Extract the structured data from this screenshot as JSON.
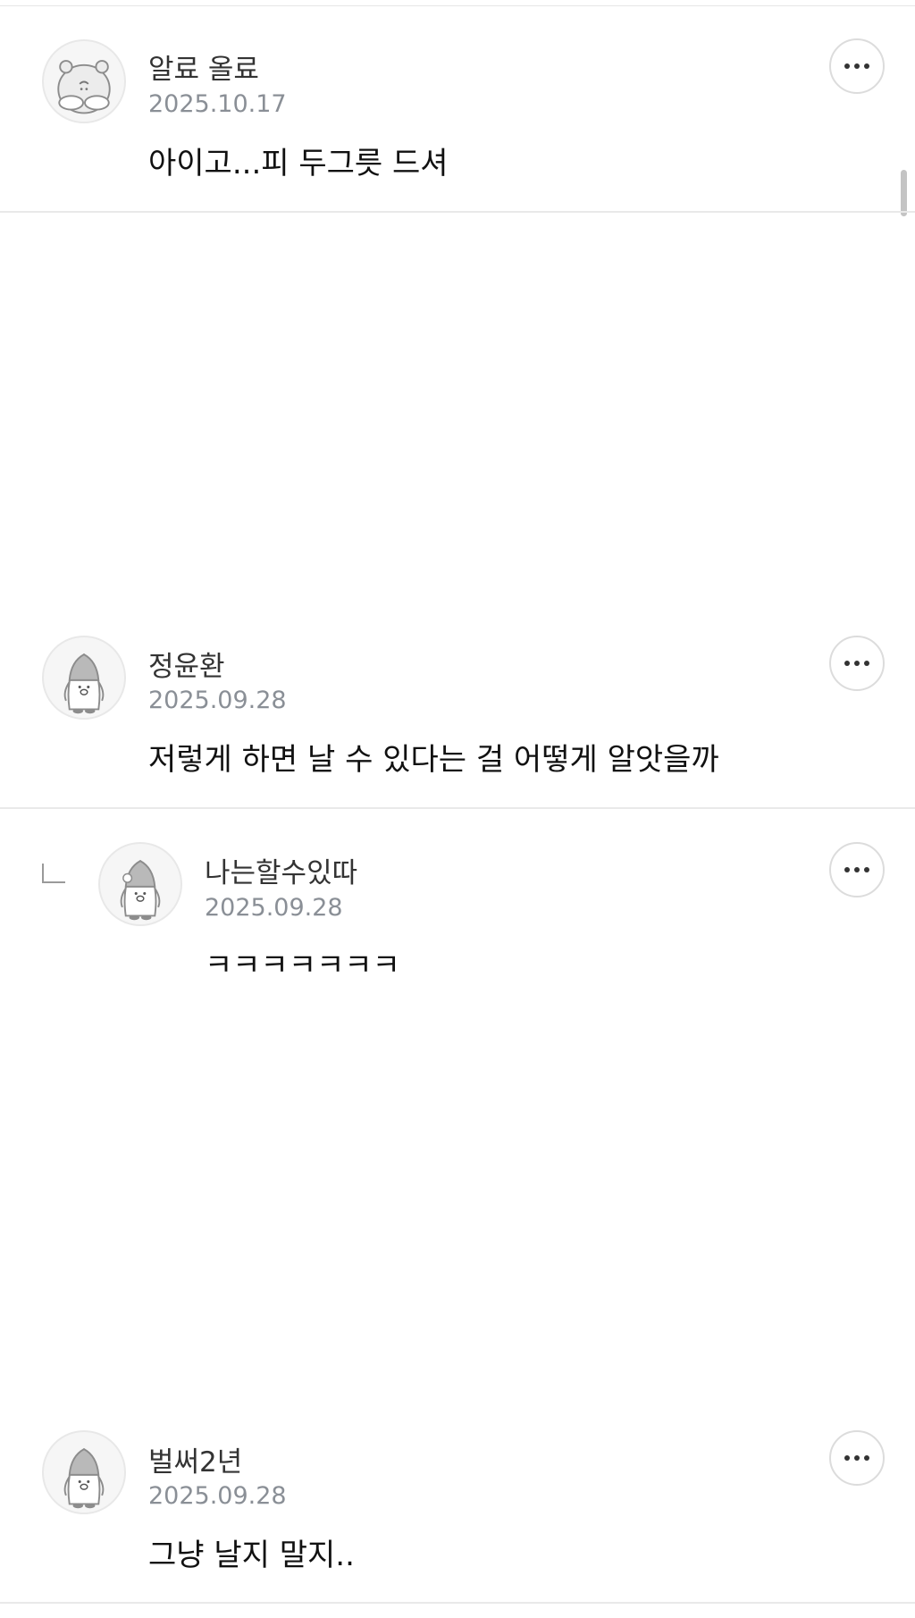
{
  "comments": [
    {
      "author": "알료 올료",
      "date": "2025.10.17",
      "text": "아이고...피 두그릇 드셔",
      "avatar_icon": "hamster-avatar-icon",
      "is_reply": false
    },
    {
      "author": "정윤환",
      "date": "2025.09.28",
      "text": "저렇게 하면 날 수 있다는 걸 어떻게 알앗을까",
      "avatar_icon": "penguin-avatar-icon",
      "is_reply": false
    },
    {
      "author": "나는할수있따",
      "date": "2025.09.28",
      "text": "ㅋㅋㅋㅋㅋㅋㅋ",
      "avatar_icon": "penguin-avatar-icon",
      "is_reply": true
    },
    {
      "author": "벌써2년",
      "date": "2025.09.28",
      "text": "그냥 날지 말지..",
      "avatar_icon": "penguin-avatar-icon",
      "is_reply": false
    }
  ],
  "icons": {
    "more": "more-options-icon",
    "reply": "reply-indent-icon"
  },
  "colors": {
    "date": "#8a8f96",
    "divider": "#e9e9e9",
    "author": "#333333"
  }
}
